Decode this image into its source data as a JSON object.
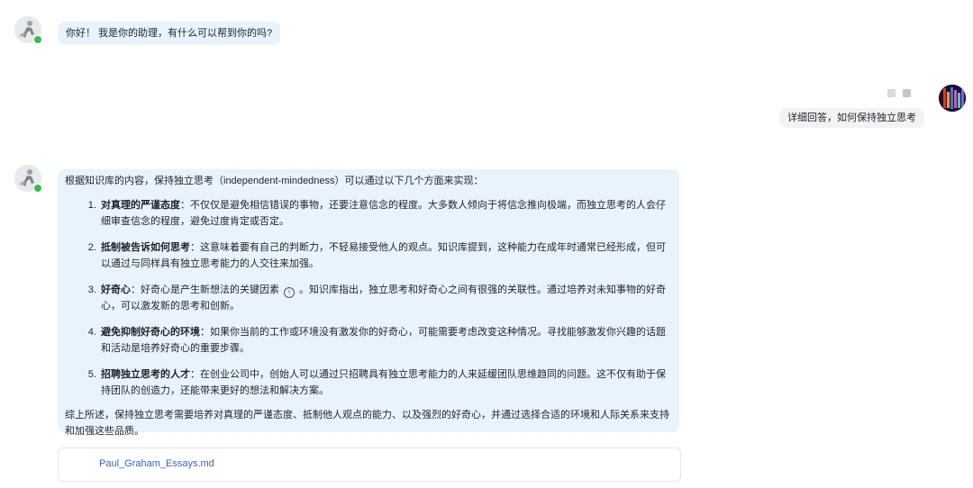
{
  "greeting": {
    "text": "你好！ 我是你的助理，有什么可以帮到你的吗?"
  },
  "user_message": {
    "text": "详细回答，如何保持独立思考"
  },
  "answer": {
    "intro": "根据知识库的内容，保持独立思考（independent-mindedness）可以通过以下几个方面来实现：",
    "items": [
      {
        "title": "对真理的严谨态度",
        "body": "：不仅仅是避免相信错误的事物，还要注意信念的程度。大多数人倾向于将信念推向极端，而独立思考的人会仔细审查信念的程度，避免过度肯定或否定。"
      },
      {
        "title": "抵制被告诉如何思考",
        "body": "：这意味着要有自己的判断力，不轻易接受他人的观点。知识库提到，这种能力在成年时通常已经形成，但可以通过与同样具有独立思考能力的人交往来加强。"
      },
      {
        "title": "好奇心",
        "body_before": "：好奇心是产生新想法的关键因素",
        "body_after": "。知识库指出，独立思考和好奇心之间有很强的关联性。通过培养对未知事物的好奇心，可以激发新的思考和创新。"
      },
      {
        "title": "避免抑制好奇心的环境",
        "body": "：如果你当前的工作或环境没有激发你的好奇心，可能需要考虑改变这种情况。寻找能够激发你兴趣的话题和活动是培养好奇心的重要步骤。"
      },
      {
        "title": "招聘独立思考的人才",
        "body": "：在创业公司中，创始人可以通过只招聘具有独立思考能力的人来延缓团队思维趋同的问题。这不仅有助于保持团队的创造力，还能带来更好的想法和解决方案。"
      }
    ],
    "summary": "综上所述，保持独立思考需要培养对真理的严谨态度、抵制他人观点的能力、以及强烈的好奇心，并通过选择合适的环境和人际关系来支持和加强这些品质。"
  },
  "info_icon_glyph": "i",
  "source": {
    "filename": "Paul_Graham_Essays.md"
  },
  "colors": {
    "bot_bubble": "#e9f3fd",
    "user_bubble": "#f2f3f5",
    "link": "#3560d8",
    "online": "#3fb950"
  }
}
